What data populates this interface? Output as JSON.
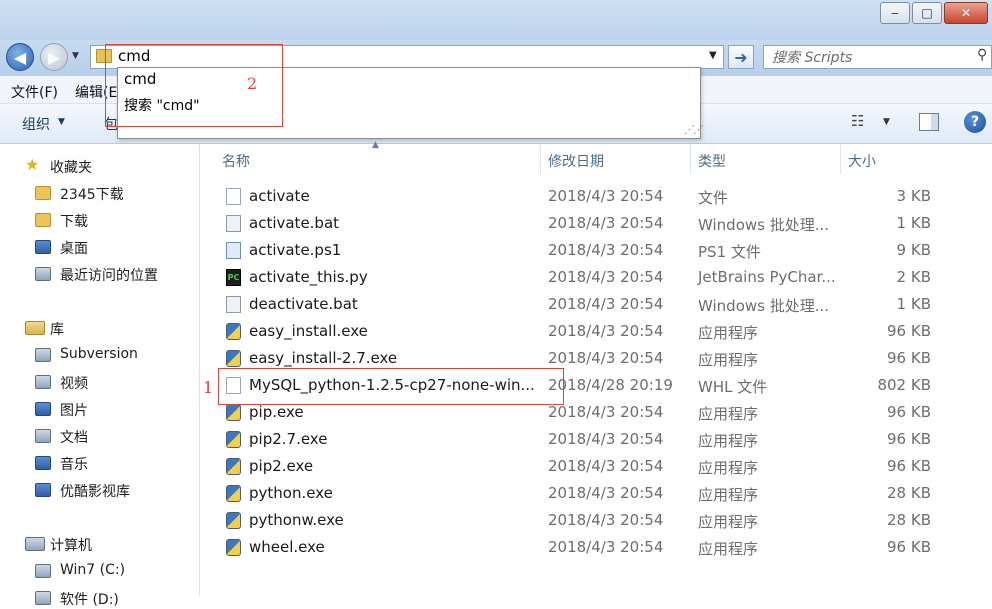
{
  "window": {
    "minimize": "‒",
    "maximize": "□",
    "close": "✕"
  },
  "address": {
    "value": "cmd",
    "go": "➜"
  },
  "search": {
    "placeholder": "搜索 Scripts"
  },
  "menu": {
    "file": "文件(F)",
    "edit": "编辑(E"
  },
  "toolbar": {
    "organize": "组织",
    "include": "包"
  },
  "autocomplete": {
    "items": [
      "cmd",
      "搜索 \"cmd\""
    ]
  },
  "annotations": {
    "label1": "1",
    "label2": "2",
    "color": "#d9453c"
  },
  "sidebar": {
    "favorites": {
      "label": "收藏夹",
      "items": [
        "2345下载",
        "下载",
        "桌面",
        "最近访问的位置"
      ]
    },
    "libraries": {
      "label": "库",
      "items": [
        "Subversion",
        "视频",
        "图片",
        "文档",
        "音乐",
        "优酷影视库"
      ]
    },
    "computer": {
      "label": "计算机",
      "items": [
        "Win7 (C:)",
        "软件 (D:)"
      ]
    }
  },
  "columns": {
    "name": "名称",
    "date": "修改日期",
    "type": "类型",
    "size": "大小"
  },
  "files": [
    {
      "name": "activate",
      "date": "2018/4/3 20:54",
      "type": "文件",
      "size": "3 KB",
      "icon": "doc"
    },
    {
      "name": "activate.bat",
      "date": "2018/4/3 20:54",
      "type": "Windows 批处理...",
      "size": "1 KB",
      "icon": "bat"
    },
    {
      "name": "activate.ps1",
      "date": "2018/4/3 20:54",
      "type": "PS1 文件",
      "size": "9 KB",
      "icon": "ps1"
    },
    {
      "name": "activate_this.py",
      "date": "2018/4/3 20:54",
      "type": "JetBrains PyChar...",
      "size": "2 KB",
      "icon": "pyc"
    },
    {
      "name": "deactivate.bat",
      "date": "2018/4/3 20:54",
      "type": "Windows 批处理...",
      "size": "1 KB",
      "icon": "bat"
    },
    {
      "name": "easy_install.exe",
      "date": "2018/4/3 20:54",
      "type": "应用程序",
      "size": "96 KB",
      "icon": "exe"
    },
    {
      "name": "easy_install-2.7.exe",
      "date": "2018/4/3 20:54",
      "type": "应用程序",
      "size": "96 KB",
      "icon": "exe"
    },
    {
      "name": "MySQL_python-1.2.5-cp27-none-win...",
      "date": "2018/4/28 20:19",
      "type": "WHL 文件",
      "size": "802 KB",
      "icon": "doc"
    },
    {
      "name": "pip.exe",
      "date": "2018/4/3 20:54",
      "type": "应用程序",
      "size": "96 KB",
      "icon": "exe"
    },
    {
      "name": "pip2.7.exe",
      "date": "2018/4/3 20:54",
      "type": "应用程序",
      "size": "96 KB",
      "icon": "exe"
    },
    {
      "name": "pip2.exe",
      "date": "2018/4/3 20:54",
      "type": "应用程序",
      "size": "96 KB",
      "icon": "exe"
    },
    {
      "name": "python.exe",
      "date": "2018/4/3 20:54",
      "type": "应用程序",
      "size": "28 KB",
      "icon": "exe"
    },
    {
      "name": "pythonw.exe",
      "date": "2018/4/3 20:54",
      "type": "应用程序",
      "size": "28 KB",
      "icon": "exe"
    },
    {
      "name": "wheel.exe",
      "date": "2018/4/3 20:54",
      "type": "应用程序",
      "size": "96 KB",
      "icon": "exe"
    }
  ]
}
